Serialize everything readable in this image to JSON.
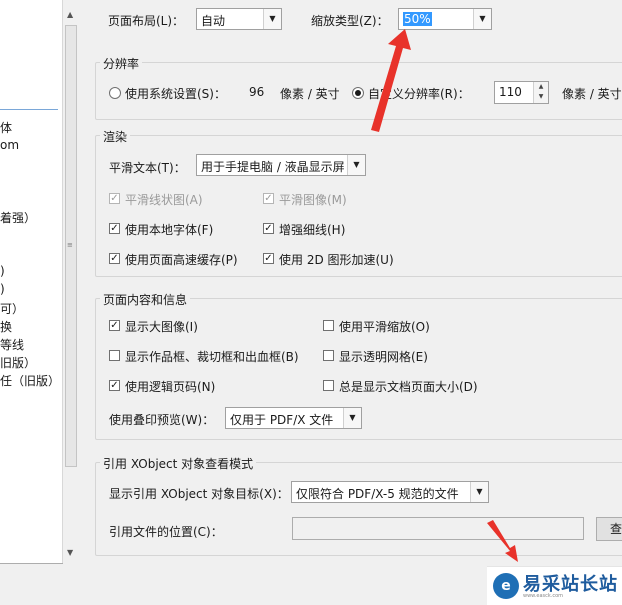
{
  "left_list": {
    "items": [
      "体",
      "om",
      "着强）",
      ")",
      ")",
      "可）",
      "换",
      "等线",
      "旧版）",
      "任（旧版）"
    ]
  },
  "page_layout": {
    "label": "页面布局(L)：",
    "value": "自动"
  },
  "zoom_type": {
    "label": "缩放类型(Z)：",
    "value": "50%"
  },
  "resolution": {
    "title": "分辨率",
    "system_label": "使用系统设置(S)：",
    "system_value": "96",
    "unit1": "像素 / 英寸",
    "custom_label": "自定义分辨率(R)：",
    "custom_value": "110",
    "unit2": "像素 / 英寸",
    "selected": "custom"
  },
  "render": {
    "title": "渲染",
    "smooth_text_label": "平滑文本(T)：",
    "smooth_text_value": "用于手提电脑 / 液晶显示屏",
    "options": [
      {
        "label": "平滑线状图(A)",
        "checked": true,
        "enabled": false
      },
      {
        "label": "平滑图像(M)",
        "checked": true,
        "enabled": false
      },
      {
        "label": "使用本地字体(F)",
        "checked": true,
        "enabled": true
      },
      {
        "label": "增强细线(H)",
        "checked": true,
        "enabled": true
      },
      {
        "label": "使用页面高速缓存(P)",
        "checked": true,
        "enabled": true
      },
      {
        "label": "使用 2D 图形加速(U)",
        "checked": true,
        "enabled": true
      }
    ]
  },
  "page_content": {
    "title": "页面内容和信息",
    "options": [
      {
        "label": "显示大图像(I)",
        "checked": true
      },
      {
        "label": "使用平滑缩放(O)",
        "checked": false
      },
      {
        "label": "显示作品框、裁切框和出血框(B)",
        "checked": false
      },
      {
        "label": "显示透明网格(E)",
        "checked": false
      },
      {
        "label": "使用逻辑页码(N)",
        "checked": true
      },
      {
        "label": "总是显示文档页面大小(D)",
        "checked": false
      }
    ],
    "overprint_label": "使用叠印预览(W)：",
    "overprint_value": "仅用于 PDF/X 文件"
  },
  "xobject": {
    "title": "引用 XObject 对象查看模式",
    "target_label": "显示引用 XObject 对象目标(X)：",
    "target_value": "仅限符合 PDF/X-5 规范的文件",
    "location_label": "引用文件的位置(C)：",
    "location_value": "",
    "browse_label": "查"
  },
  "watermark": {
    "name": "易采站长站",
    "sub": "www.easck.com"
  },
  "colors": {
    "accent_arrow": "#e8322a",
    "selection": "#3399ff",
    "brand": "#1f5c9e"
  }
}
